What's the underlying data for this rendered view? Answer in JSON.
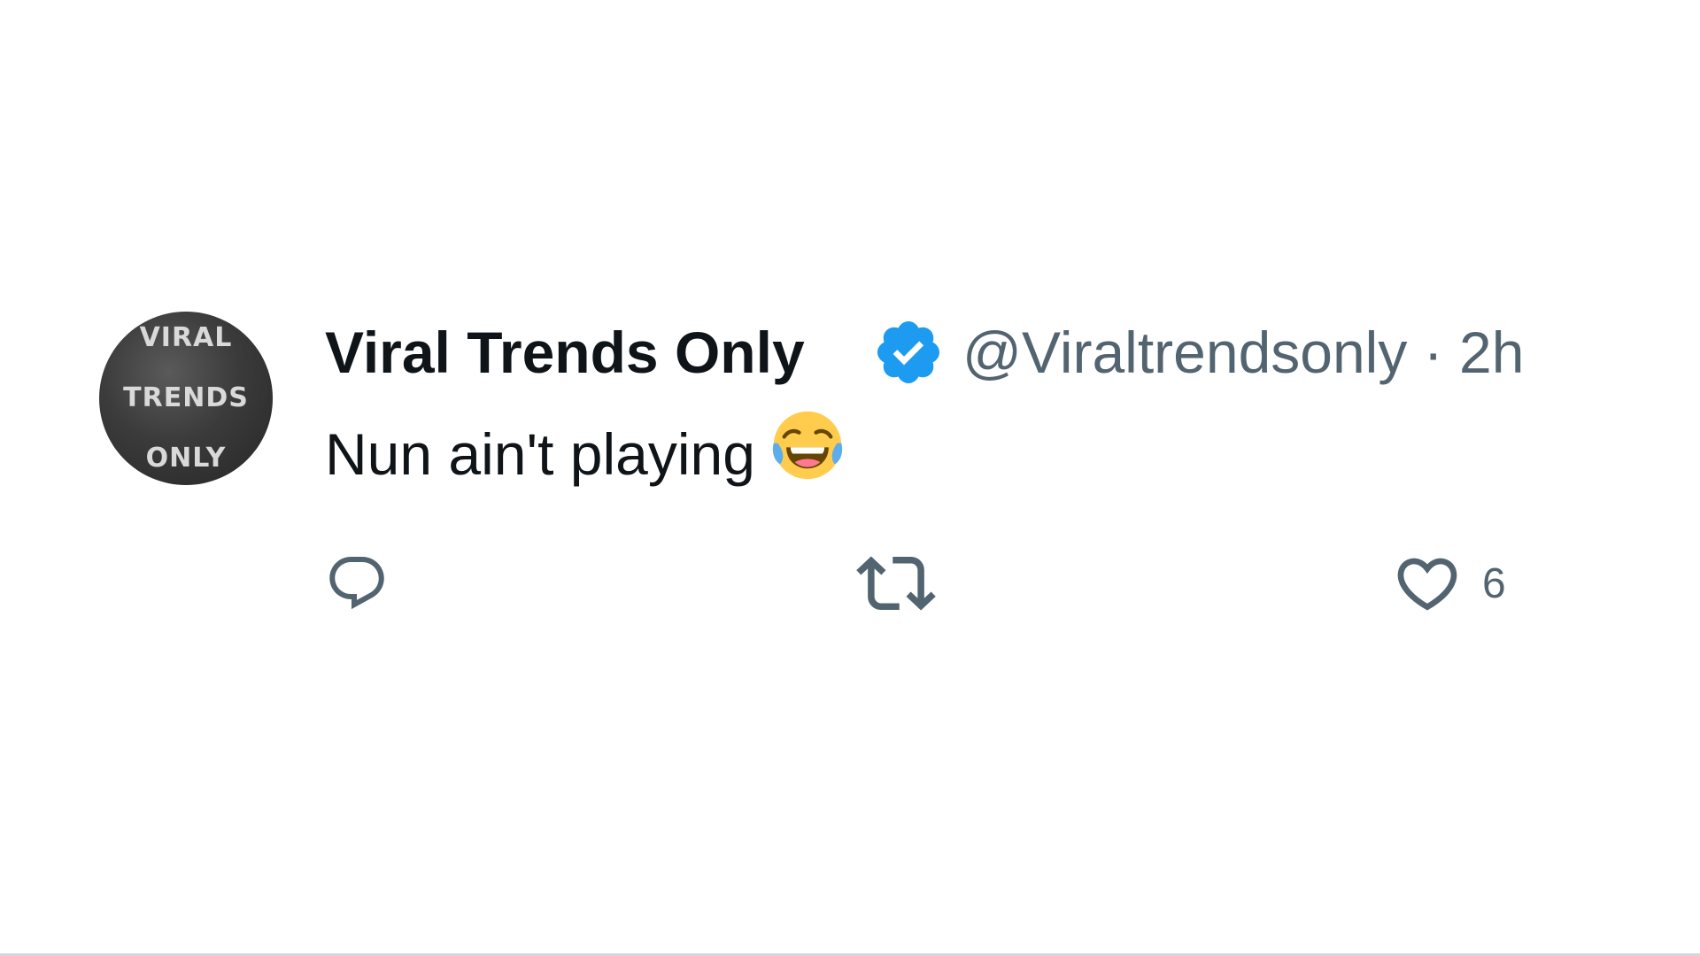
{
  "tweet": {
    "avatar": {
      "lines": [
        "VIRAL",
        "TRENDS",
        "ONLY"
      ]
    },
    "author": {
      "display_name": "Viral Trends Only",
      "handle": "@Viraltrendsonly",
      "separator": "·",
      "time": "2h",
      "verified_icon": "verified-badge-icon",
      "verified_color": "#1d9bf0"
    },
    "text": "Nun ain't playing",
    "emoji_icon": "face-with-tears-of-joy-icon",
    "actions": {
      "reply": {
        "icon": "reply-icon",
        "count": ""
      },
      "retweet": {
        "icon": "retweet-icon",
        "count": ""
      },
      "like": {
        "icon": "heart-icon",
        "count": "6"
      }
    }
  },
  "colors": {
    "text_primary": "#0f1419",
    "text_secondary": "#536471",
    "accent": "#1d9bf0"
  }
}
